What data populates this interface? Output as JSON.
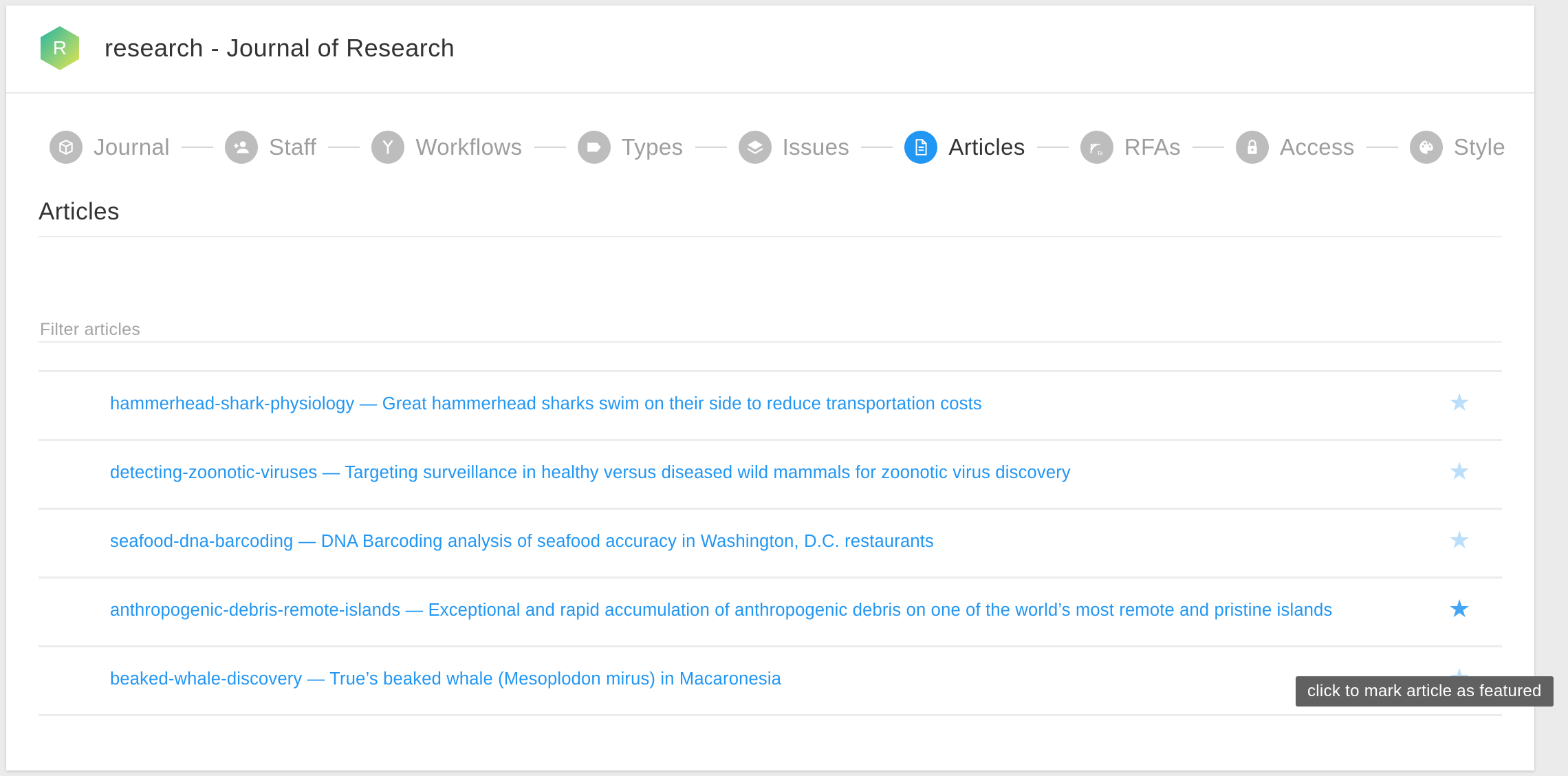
{
  "app": {
    "logo_letter": "R",
    "title": "research - Journal of Research"
  },
  "stepper": [
    {
      "label": "Journal",
      "icon": "book-icon",
      "active": false
    },
    {
      "label": "Staff",
      "icon": "person-add-icon",
      "active": false
    },
    {
      "label": "Workflows",
      "icon": "merge-icon",
      "active": false
    },
    {
      "label": "Types",
      "icon": "label-icon",
      "active": false
    },
    {
      "label": "Issues",
      "icon": "layers-icon",
      "active": false
    },
    {
      "label": "Articles",
      "icon": "document-icon",
      "active": true
    },
    {
      "label": "RFAs",
      "icon": "rfa-icon",
      "active": false
    },
    {
      "label": "Access",
      "icon": "lock-icon",
      "active": false
    },
    {
      "label": "Style",
      "icon": "palette-icon",
      "active": false
    }
  ],
  "page": {
    "title": "Articles",
    "filter_placeholder": "Filter articles"
  },
  "articles": [
    {
      "text": "hammerhead-shark-physiology — Great hammerhead sharks swim on their side to reduce transportation costs",
      "featured": false
    },
    {
      "text": "detecting-zoonotic-viruses — Targeting surveillance in healthy versus diseased wild mammals for zoonotic virus discovery",
      "featured": false
    },
    {
      "text": "seafood-dna-barcoding — DNA Barcoding analysis of seafood accuracy in Washington, D.C. restaurants",
      "featured": false
    },
    {
      "text": "anthropogenic-debris-remote-islands — Exceptional and rapid accumulation of anthropogenic debris on one of the world’s most remote and pristine islands",
      "featured": true
    },
    {
      "text": "beaked-whale-discovery — True’s beaked whale (Mesoplodon mirus) in Macaronesia",
      "featured": false
    }
  ],
  "tooltip": "click to mark article as featured",
  "colors": {
    "accent": "#2196f3",
    "inactive_step": "#bdbdbd",
    "star_unfeatured": "#bbdefb",
    "star_featured": "#42a5f5"
  }
}
